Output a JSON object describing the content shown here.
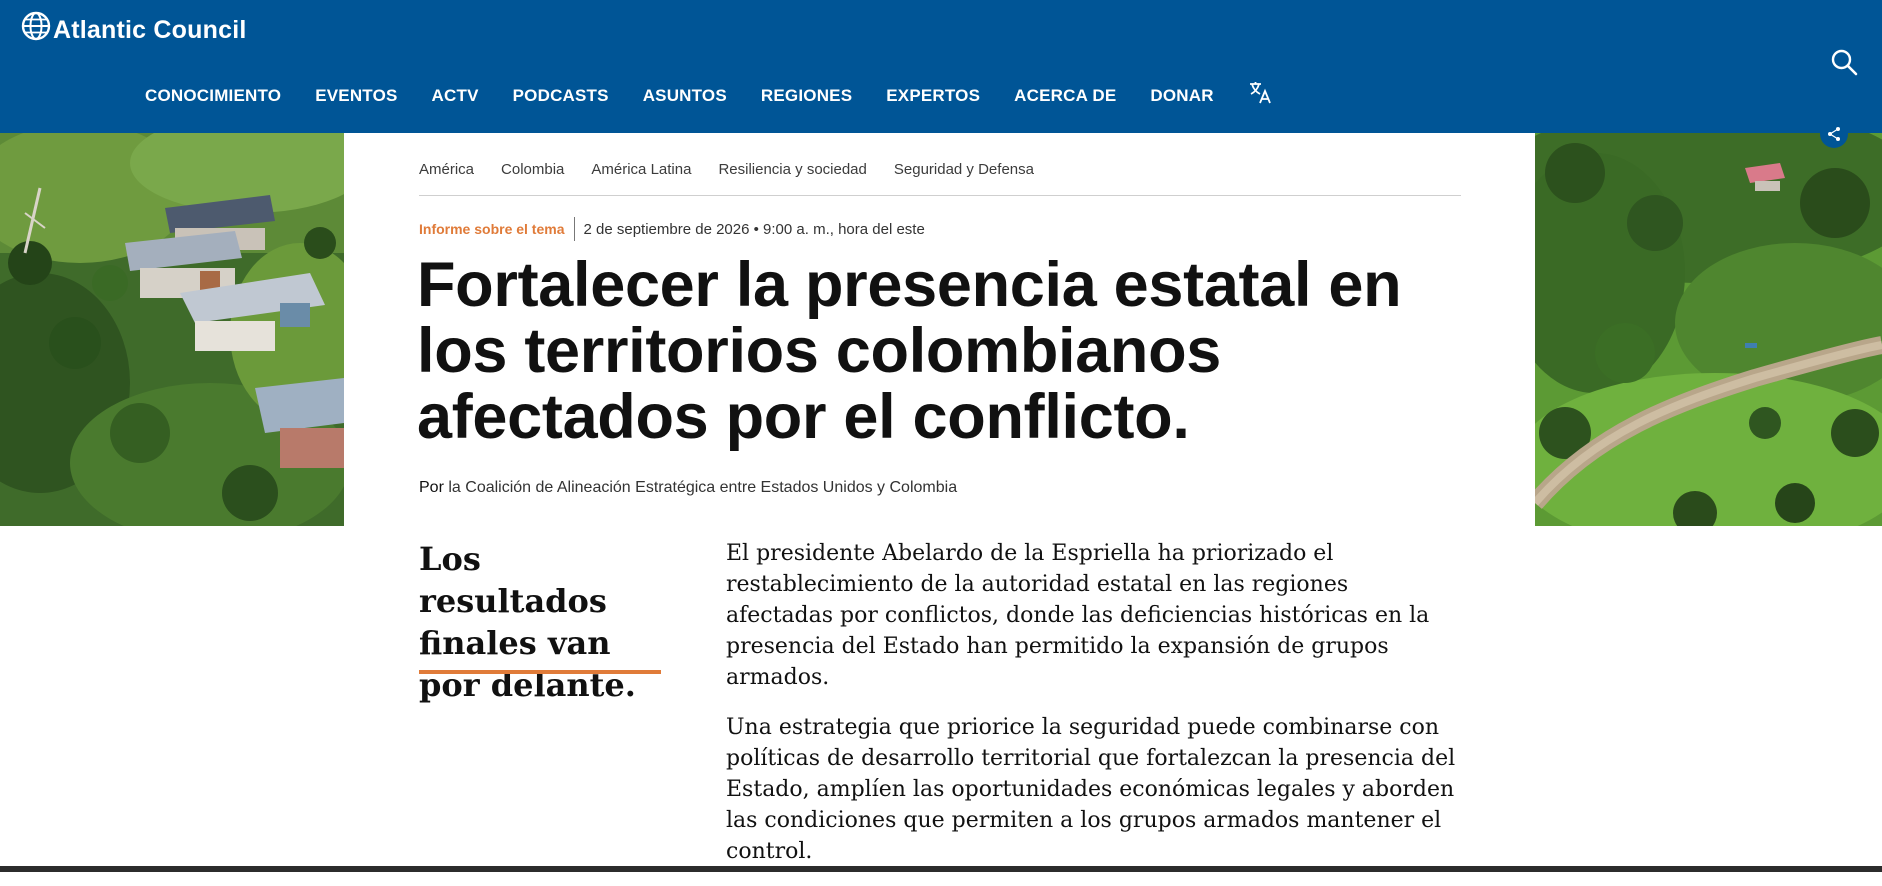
{
  "header": {
    "logo_text": "Atlantic Council",
    "logo_icon": "globe-icon",
    "search_icon": "search-icon",
    "translate_icon": "translate-icon",
    "background": "#005596",
    "nav": [
      {
        "label": "CONOCIMIENTO"
      },
      {
        "label": "EVENTOS"
      },
      {
        "label": "ACTV"
      },
      {
        "label": "PODCASTS"
      },
      {
        "label": "ASUNTOS"
      },
      {
        "label": "REGIONES"
      },
      {
        "label": "EXPERTOS"
      },
      {
        "label": "ACERCA DE"
      },
      {
        "label": "DONAR"
      }
    ]
  },
  "article": {
    "tags": [
      "América",
      "Colombia",
      "América Latina",
      "Resiliencia y sociedad",
      "Seguridad y Defensa"
    ],
    "type": "Informe sobre el tema",
    "date": "2 de septiembre de 2026 • 9:00 a. m., hora del este",
    "title": "Fortalecer la presencia estatal en los territorios colombianos afectados por el conflicto.",
    "byline_prefix": "Por",
    "byline_author": "la Coalición de Alineación Estratégica entre Estados Unidos y Colombia",
    "pullout": "Los resultados finales van por delante.",
    "paragraphs": [
      "El presidente Abelardo de la Espriella ha priorizado el restablecimiento de la autoridad estatal en las regiones afectadas por conflictos, donde las deficiencias históricas en la presencia del Estado han permitido la expansión de grupos armados.",
      "Una estrategia que priorice la seguridad puede combinarse con políticas de desarrollo territorial que fortalezcan la presencia del Estado, amplíen las oportunidades económicas legales y aborden las condiciones que permiten a los grupos armados mantener el control."
    ],
    "accent_color": "#e07b39",
    "share_icon": "share-icon"
  }
}
